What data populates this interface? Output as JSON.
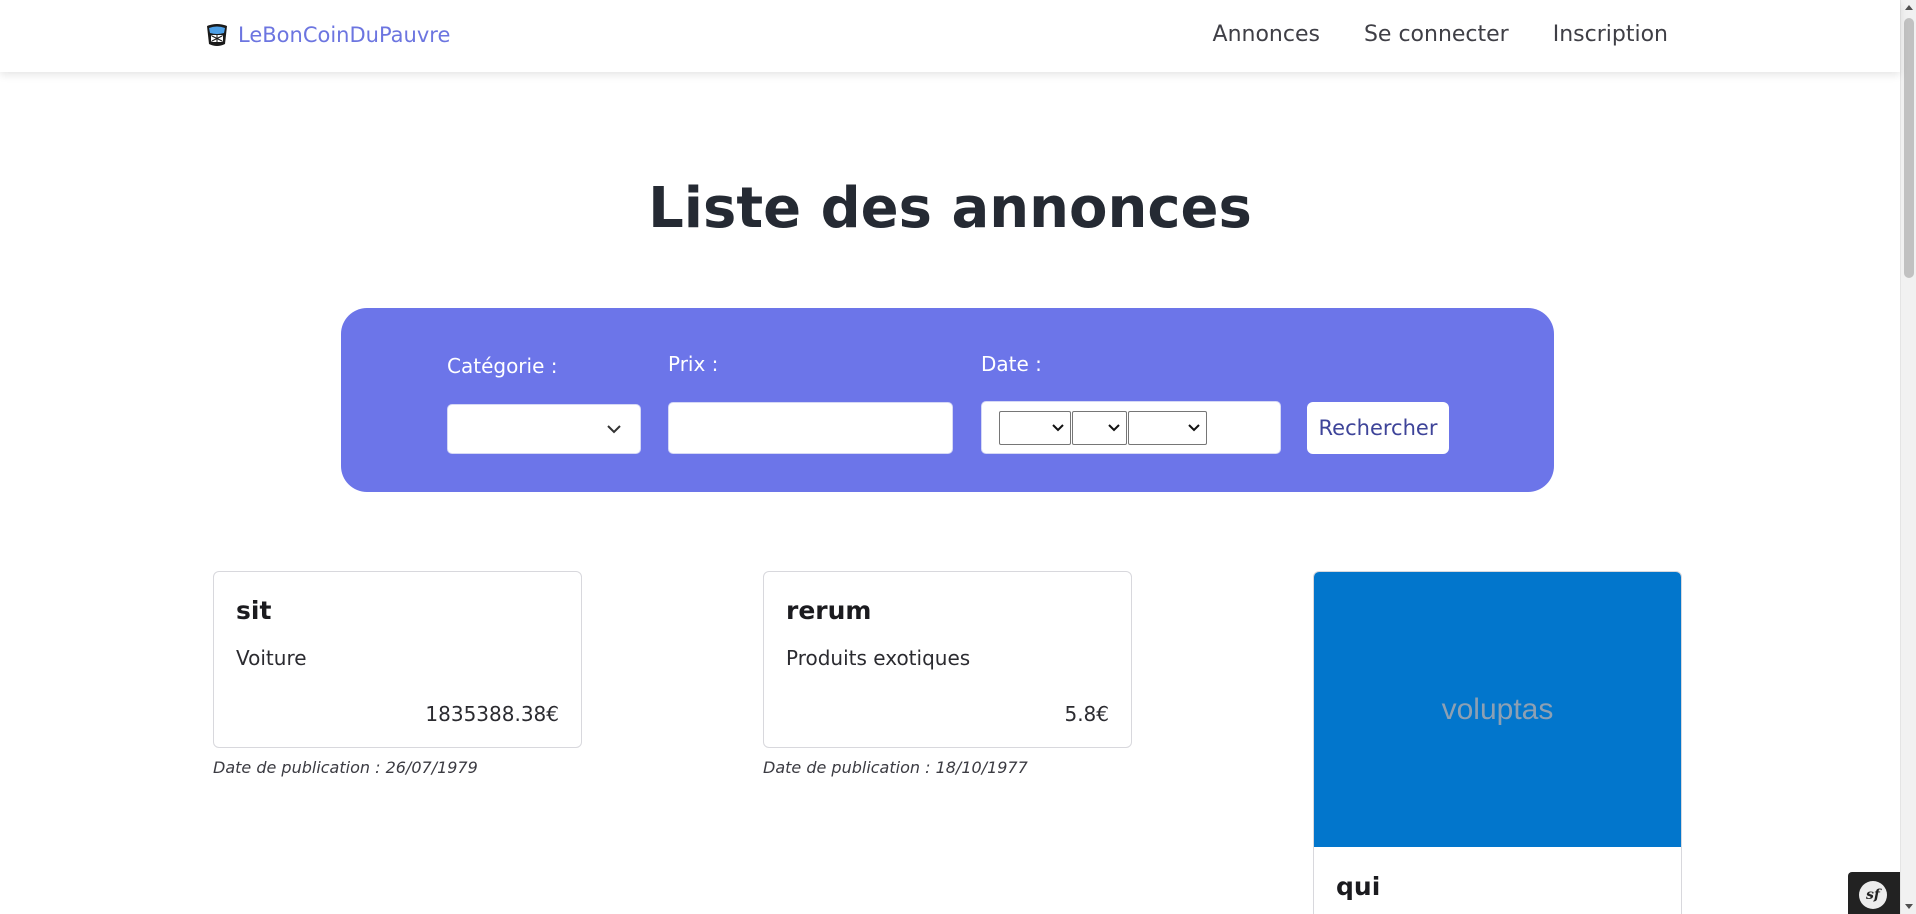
{
  "navbar": {
    "brand": "LeBonCoinDuPauvre",
    "links": [
      "Annonces",
      "Se connecter",
      "Inscription"
    ]
  },
  "title": "Liste des annonces",
  "search": {
    "category_label": "Catégorie :",
    "price_label": "Prix :",
    "date_label": "Date :",
    "button_label": "Rechercher",
    "category_value": "",
    "price_value": ""
  },
  "listings": [
    {
      "title": "sit",
      "category": "Voiture",
      "price": "1835388.38€",
      "date": "Date de publication : 26/07/1979"
    },
    {
      "title": "rerum",
      "category": "Produits exotiques",
      "price": "5.8€",
      "date": "Date de publication : 18/10/1977"
    },
    {
      "title": "qui",
      "image_text": "voluptas"
    }
  ],
  "colors": {
    "accent": "#6c75e9",
    "brand": "#6c75e0",
    "image_bg": "#0276cc"
  },
  "icons": {
    "brand_logo": "basket-logo-icon",
    "dropdown": "chevron-down-icon",
    "debug": "symfony-icon"
  }
}
